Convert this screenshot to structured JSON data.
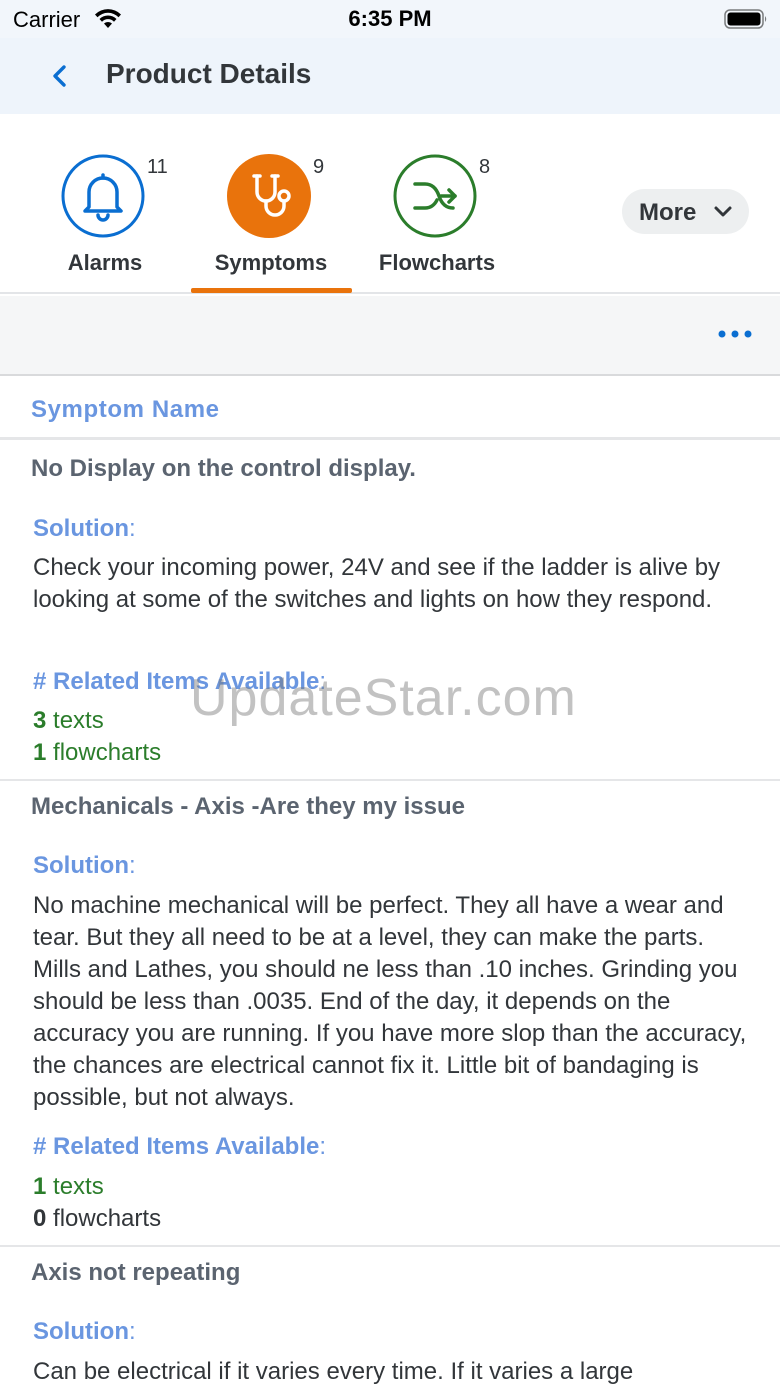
{
  "status_bar": {
    "carrier": "Carrier",
    "time": "6:35 PM"
  },
  "nav": {
    "title": "Product Details"
  },
  "tabs": [
    {
      "label": "Alarms",
      "count": "11",
      "icon": "bell-icon",
      "color": "#0a6ed1"
    },
    {
      "label": "Symptoms",
      "count": "9",
      "icon": "stethoscope-icon",
      "color": "#e9730c"
    },
    {
      "label": "Flowcharts",
      "count": "8",
      "icon": "flowchart-icon",
      "color": "#2b7d2b"
    }
  ],
  "more": {
    "label": "More"
  },
  "list": {
    "header": "Symptom Name",
    "solution_label": "Solution",
    "related_label": "# Related Items Available",
    "items": [
      {
        "name": "No Display on the control display.",
        "solution": "Check your incoming power, 24V and see if the ladder is alive by looking at some of the switches and lights on how they respond.",
        "texts_count": "3",
        "texts_label": "texts",
        "flowcharts_count": "1",
        "flowcharts_label": "flowcharts"
      },
      {
        "name": "Mechanicals - Axis -Are they my issue",
        "solution": "No machine mechanical will be perfect. They all have a wear and tear. But they all need to be at a level, they can make the parts. Mills and Lathes, you should ne less than .10 inches. Grinding you should be less than .0035. End of the day, it depends on the accuracy you are running. If you have more slop than the accuracy, the chances are electrical cannot fix it. Little bit of bandaging is possible, but not always.",
        "texts_count": "1",
        "texts_label": "texts",
        "flowcharts_count": "0",
        "flowcharts_label": "flowcharts"
      },
      {
        "name": "Axis not repeating",
        "solution": "Can be electrical if it varies every time. If it varies a large"
      }
    ]
  },
  "watermark": "UpdateStar.com",
  "colors": {
    "accent_blue": "#6a96e0",
    "active_tab": "#e9730c",
    "count_green": "#2b7d2b"
  }
}
